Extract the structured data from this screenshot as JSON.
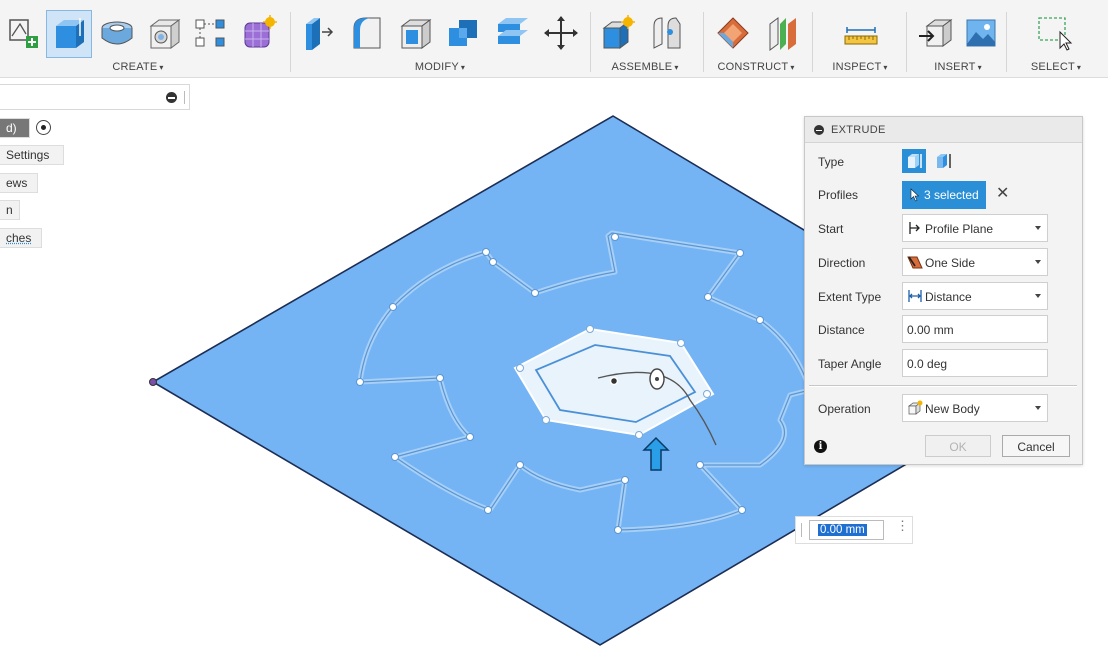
{
  "toolbar": {
    "groups": [
      {
        "label": "CREATE",
        "caret": "▾"
      },
      {
        "label": "MODIFY",
        "caret": "▾"
      },
      {
        "label": "ASSEMBLE",
        "caret": "▾"
      },
      {
        "label": "CONSTRUCT",
        "caret": "▾"
      },
      {
        "label": "INSPECT",
        "caret": "▾"
      },
      {
        "label": "INSERT",
        "caret": "▾"
      },
      {
        "label": "SELECT",
        "caret": "▾"
      }
    ],
    "icons": [
      "create-sketch-icon",
      "extrude-icon",
      "revolve-icon",
      "hole-icon",
      "pattern-icon",
      "form-icon",
      "press-pull-icon",
      "fillet-icon",
      "shell-icon",
      "combine-icon",
      "replace-face-icon",
      "move-icon",
      "new-component-icon",
      "joint-icon",
      "offset-plane-icon",
      "midplane-icon",
      "measure-icon",
      "insert-derive-icon",
      "insert-canvas-icon",
      "select-window-icon"
    ]
  },
  "browser": {
    "items": [
      {
        "label": "d)"
      },
      {
        "label": "Settings"
      },
      {
        "label": "ews"
      },
      {
        "label": "n"
      },
      {
        "label": "ches"
      }
    ]
  },
  "extrude": {
    "title": "EXTRUDE",
    "type_label": "Type",
    "profiles_label": "Profiles",
    "profiles_value": "3 selected",
    "start_label": "Start",
    "start_value": "Profile Plane",
    "direction_label": "Direction",
    "direction_value": "One Side",
    "extent_label": "Extent Type",
    "extent_value": "Distance",
    "distance_label": "Distance",
    "distance_value": "0.00 mm",
    "taper_label": "Taper Angle",
    "taper_value": "0.0 deg",
    "operation_label": "Operation",
    "operation_value": "New Body",
    "ok": "OK",
    "cancel": "Cancel",
    "clear": "✕",
    "info": "i"
  },
  "canvas": {
    "distance_input": "0.00 mm",
    "more": "⋮"
  },
  "colors": {
    "plane": "#74b4f5",
    "plane_edge": "#1c2e55",
    "selected_profile": "#e8f3fb",
    "dialog_accent": "#2a8fd6"
  }
}
